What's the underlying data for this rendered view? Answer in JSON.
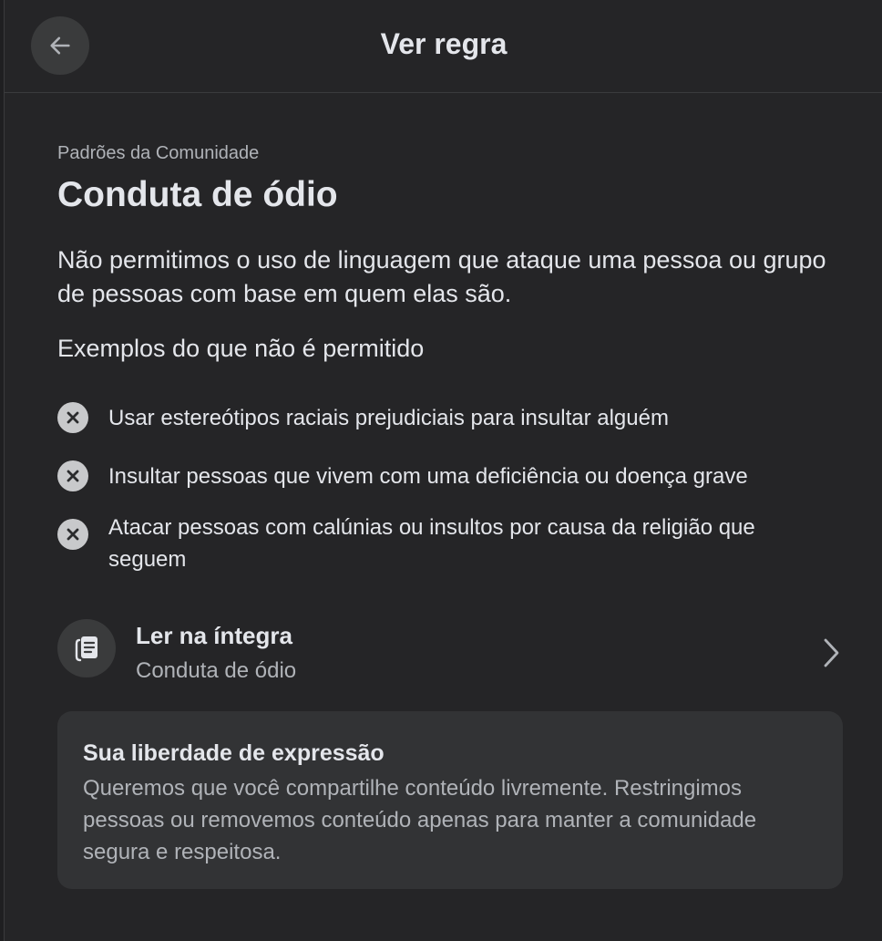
{
  "header": {
    "title": "Ver regra"
  },
  "rule": {
    "eyebrow": "Padrões da Comunidade",
    "title": "Conduta de ódio",
    "description": "Não permitimos o uso de linguagem que ataque uma pessoa ou grupo de pessoas com base em quem elas são.",
    "examples_label": "Exemplos do que não é permitido",
    "examples": [
      "Usar estereótipos raciais prejudiciais para insultar alguém",
      "Insultar pessoas que vivem com uma deficiência ou doença grave",
      "Atacar pessoas com calúnias ou insultos por causa da religião que seguem"
    ]
  },
  "read_full": {
    "title": "Ler na íntegra",
    "subtitle": "Conduta de ódio"
  },
  "free_expression": {
    "title": "Sua liberdade de expressão",
    "body": "Queremos que você compartilhe conteúdo livremente. Restringimos pessoas ou removemos conteúdo apenas para manter a comunidade segura e respeitosa."
  },
  "icons": {
    "back": "arrow-left-icon",
    "example": "x-circle-icon",
    "read": "document-icon",
    "chevron": "chevron-right-icon"
  },
  "colors": {
    "background": "#252527",
    "card": "#323335",
    "text_primary": "#e4e6eb",
    "text_secondary": "#b0b3b8",
    "icon_circle": "#3a3b3c"
  }
}
